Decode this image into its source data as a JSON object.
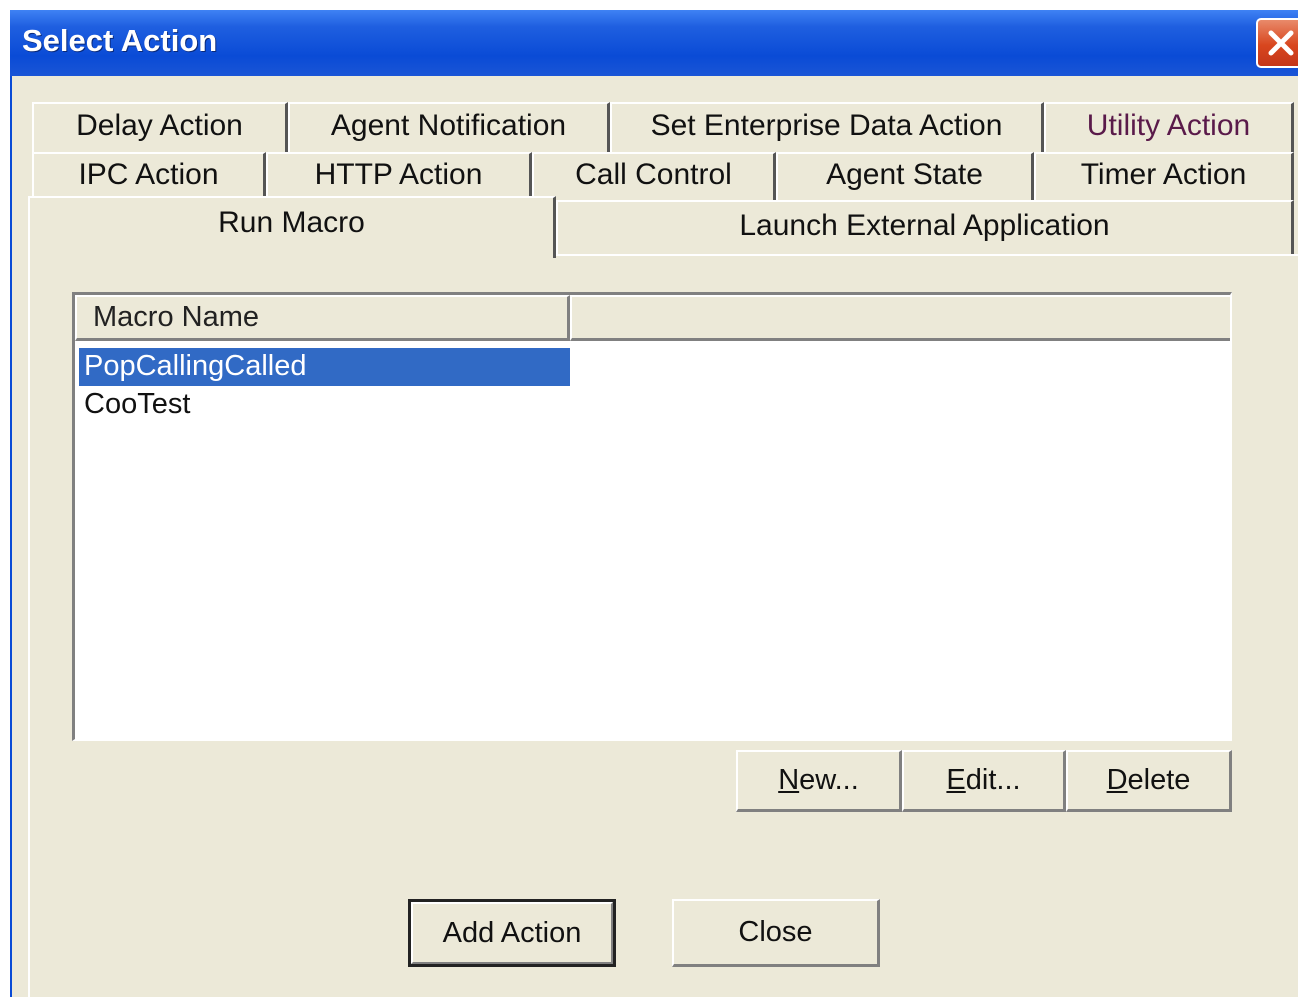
{
  "window": {
    "title": "Select Action"
  },
  "tabs": {
    "row1": [
      "Delay Action",
      "Agent Notification",
      "Set Enterprise Data Action",
      "Utility Action"
    ],
    "row2": [
      "IPC Action",
      "HTTP Action",
      "Call Control",
      "Agent State",
      "Timer Action"
    ],
    "row3": [
      "Run Macro",
      "Launch External Application"
    ],
    "active": "Run Macro"
  },
  "macro_list": {
    "columns": [
      "Macro Name",
      ""
    ],
    "items": [
      "PopCallingCalled",
      "CooTest"
    ],
    "selected_index": 0
  },
  "buttons": {
    "new": {
      "mnemonic": "N",
      "rest": "ew..."
    },
    "edit": {
      "mnemonic": "E",
      "rest": "dit..."
    },
    "delete": {
      "mnemonic": "D",
      "rest": "elete"
    },
    "add_action": "Add Action",
    "close": "Close"
  },
  "colors": {
    "titlebar": "#0a4bd6",
    "selection": "#316ac5",
    "dialog_face": "#ece9d8",
    "close_button": "#d8461e"
  }
}
